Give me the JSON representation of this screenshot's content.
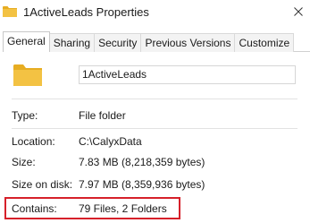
{
  "window": {
    "title": "1ActiveLeads Properties",
    "close_icon": "close-icon",
    "folder_icon": "folder-icon"
  },
  "tabs": [
    {
      "label": "General",
      "active": true
    },
    {
      "label": "Sharing"
    },
    {
      "label": "Security"
    },
    {
      "label": "Previous Versions"
    },
    {
      "label": "Customize"
    }
  ],
  "general": {
    "folder_name": "1ActiveLeads",
    "rows": {
      "type": {
        "label": "Type:",
        "value": "File folder"
      },
      "location": {
        "label": "Location:",
        "value": "C:\\CalyxData"
      },
      "size": {
        "label": "Size:",
        "value": "7.83 MB (8,218,359 bytes)"
      },
      "size_on_disk": {
        "label": "Size on disk:",
        "value": "7.97 MB (8,359,936 bytes)"
      },
      "contains": {
        "label": "Contains:",
        "value": "79 Files, 2 Folders"
      }
    }
  },
  "colors": {
    "folder": "#f3c243",
    "folder_dark": "#e7ad22",
    "highlight": "#d6202a"
  }
}
